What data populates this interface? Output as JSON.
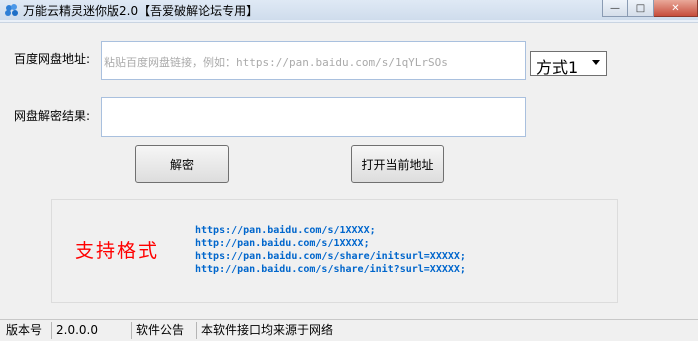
{
  "window": {
    "title": "万能云精灵迷你版2.0【吾爱破解论坛专用】",
    "minimize_icon": "minimize-icon",
    "maximize_icon": "maximize-icon",
    "close_icon": "close-icon",
    "close_color": "#c74d3b"
  },
  "form": {
    "url_label": "百度网盘地址:",
    "url_placeholder": "粘贴百度网盘链接，例如：https://pan.baidu.com/s/1qYLrSOs",
    "url_value": "",
    "method_selected": "方式1",
    "result_label": "网盘解密结果:",
    "result_value": "",
    "decrypt_button": "解密",
    "open_button": "打开当前地址"
  },
  "support": {
    "title": "支持格式",
    "title_color": "#ff0000",
    "url_color": "#0066cc",
    "formats": [
      "https://pan.baidu.com/s/1XXXX;",
      "http://pan.baidu.com/s/1XXXX;",
      "https://pan.baidu.com/s/share/initsurl=XXXXX;",
      "http://pan.baidu.com/s/share/init?surl=XXXXX;"
    ]
  },
  "statusbar": {
    "version_label": "版本号",
    "version_value": "2.0.0.0",
    "notice_label": "软件公告",
    "notice_text": "本软件接口均来源于网络"
  }
}
